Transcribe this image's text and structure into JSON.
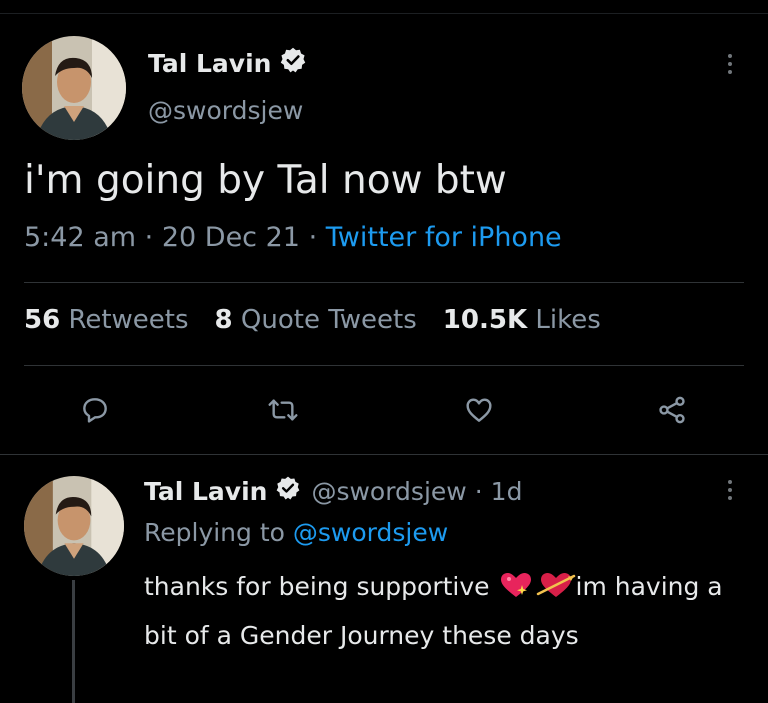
{
  "main_tweet": {
    "name": "Tal Lavin",
    "handle": "@swordsjew",
    "text": "i'm going by Tal now btw",
    "time": "5:42 am",
    "date": "20 Dec 21",
    "separator": "·",
    "source": "Twitter for iPhone",
    "stats": {
      "retweets_count": "56",
      "retweets_label": "Retweets",
      "quotes_count": "8",
      "quotes_label": "Quote Tweets",
      "likes_count": "10.5K",
      "likes_label": "Likes"
    }
  },
  "actions": [
    {
      "icon": "reply-icon"
    },
    {
      "icon": "retweet-icon"
    },
    {
      "icon": "like-icon"
    },
    {
      "icon": "share-icon"
    }
  ],
  "reply_tweet": {
    "name": "Tal Lavin",
    "handle": "@swordsjew",
    "separator": "·",
    "time": "1d",
    "replying_label": "Replying to",
    "replying_to": "@swordsjew",
    "text_part1": "thanks for being supportive ",
    "emojis": [
      "sparkling-heart-icon",
      "heart-with-arrow-icon"
    ],
    "text_part2": "im having a bit of a Gender Journey these days"
  },
  "colors": {
    "background": "#000000",
    "text": "#e7e9ea",
    "secondary": "#8b98a5",
    "accent": "#1d9bf0",
    "divider": "#2f3336"
  }
}
